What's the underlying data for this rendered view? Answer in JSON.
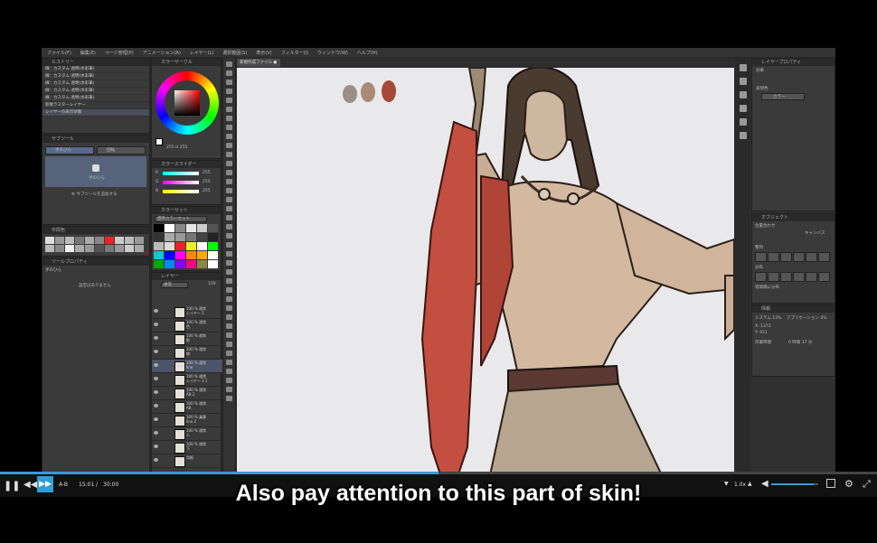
{
  "menu": [
    "ファイル(F)",
    "編集(E)",
    "ページ管理(P)",
    "アニメーション(A)",
    "レイヤー(L)",
    "選択範囲(S)",
    "表示(V)",
    "フィルター(I)",
    "ウィンドウ(W)",
    "ヘルプ(H)"
  ],
  "doc_tab": "新規作成ファイル ●",
  "history": {
    "title": "ヒストリー",
    "items": [
      "線：カスタム 透明(水彩筆)",
      "線：カスタム 透明(水彩筆)",
      "線：カスタム 透明(水彩筆)",
      "線：カスタム 透明(水彩筆)",
      "線：カスタム 透明(水彩筆)",
      "新規ラスターレイヤー",
      "レイヤーの表示状態"
    ]
  },
  "tool_property": {
    "title": "サブツール",
    "tab1": "手のひら",
    "tab2": "回転",
    "preview_label": "手のひら",
    "add_subtool": "サブツールを追加する"
  },
  "color_wheel": {
    "title": "カラーサークル",
    "values": "255 H 255"
  },
  "color_slider": {
    "title": "カラースライダー",
    "r_label": "R",
    "g_label": "G",
    "b_label": "B",
    "r": "255",
    "g": "255",
    "b": "255"
  },
  "color_set": {
    "title": "カラーセット",
    "dropdown": "標準カラーセット"
  },
  "intermediate": {
    "title": "中間色"
  },
  "approx_color": {
    "title": "近似色"
  },
  "tool_detail": {
    "title": "ツールプロパティ",
    "subtitle": "手のひら",
    "empty": "設定はありません"
  },
  "layer_panel": {
    "title": "レイヤー",
    "blend": "通常",
    "opacity": "100",
    "layers": [
      {
        "name": "100 % 通常\nレイヤー 1"
      },
      {
        "name": "100 % 通常\n色"
      },
      {
        "name": "100 % 通常\n影"
      },
      {
        "name": "100 % 通常\n線"
      },
      {
        "name": "100 % 通常\nline"
      },
      {
        "name": "100 % 通常\nレイヤー 1 2"
      },
      {
        "name": "100 % 通常\nAB 2"
      },
      {
        "name": "100 % 通常\nAB"
      },
      {
        "name": "100 % 乗算\nline 2"
      },
      {
        "name": "100 % 通常\n人"
      },
      {
        "name": "100 % 通常\n下"
      },
      {
        "name": "用紙"
      }
    ]
  },
  "layer_property": {
    "title": "レイヤープロパティ",
    "effect": "効果",
    "expression": "表現色",
    "expression_value": "カラー"
  },
  "object_panel": {
    "title": "オブジェクト",
    "align": "位置合わせ",
    "canvas": "キャンバス",
    "distribute": "整列",
    "spacing": "分布",
    "equal": "等間隔に分布"
  },
  "info_panel": {
    "title": "情報",
    "system": "システム 13%",
    "app": "アプリケーション 4%",
    "x": "X: 1373",
    "y": "Y: 911",
    "work_time_label": "作業時間",
    "work_time": "0 時間 37 分"
  },
  "player": {
    "ab": "A-B",
    "current": "15:01",
    "sep": "/",
    "total": "30:00",
    "speed": "1.0x",
    "progress": 0.5,
    "volume": 0.9
  },
  "subtitle": "Also pay attention to this part of skin!",
  "colors": {
    "accent": "#2f9ed6",
    "skin": "#d4b9a1",
    "cloth": "#b6a68f",
    "drape": "#c24f3f"
  }
}
